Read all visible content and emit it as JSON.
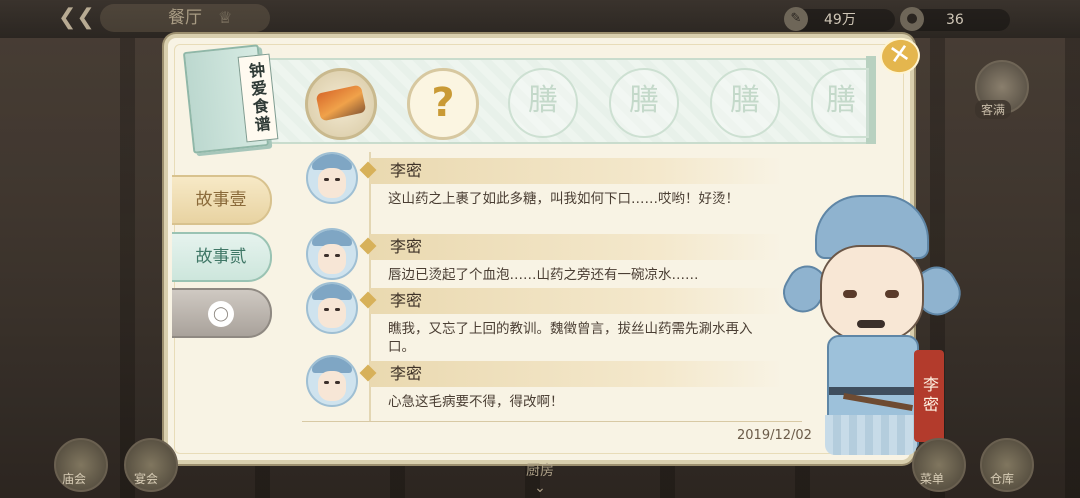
{
  "topbar": {
    "title": "餐厅",
    "currency1": "49万",
    "currency2": "36"
  },
  "side": {
    "guests_label": "客满",
    "right_label2": ""
  },
  "book_title": "钟爱食谱",
  "recipe_slots": {
    "unknown": "?",
    "locked_char": "膳"
  },
  "tabs": [
    "故事壹",
    "故事贰",
    ""
  ],
  "dialogue": [
    {
      "name": "李密",
      "text": "这山药之上裹了如此多糖，叫我如何下口……哎哟！好烫！"
    },
    {
      "name": "李密",
      "text": "唇边已烫起了个血泡……山药之旁还有一碗凉水……"
    },
    {
      "name": "李密",
      "text": "瞧我，又忘了上回的教训。魏徵曾言，拔丝山药需先涮水再入口。"
    },
    {
      "name": "李密",
      "text": "心急这毛病要不得，得改啊！"
    }
  ],
  "date": "2019/12/02",
  "character_name": "李密",
  "close_icon": "✕",
  "bottom_nav": {
    "left1": "庙会",
    "left2": "宴会",
    "center": "厨房",
    "right1": "菜单",
    "right2": "仓库"
  }
}
